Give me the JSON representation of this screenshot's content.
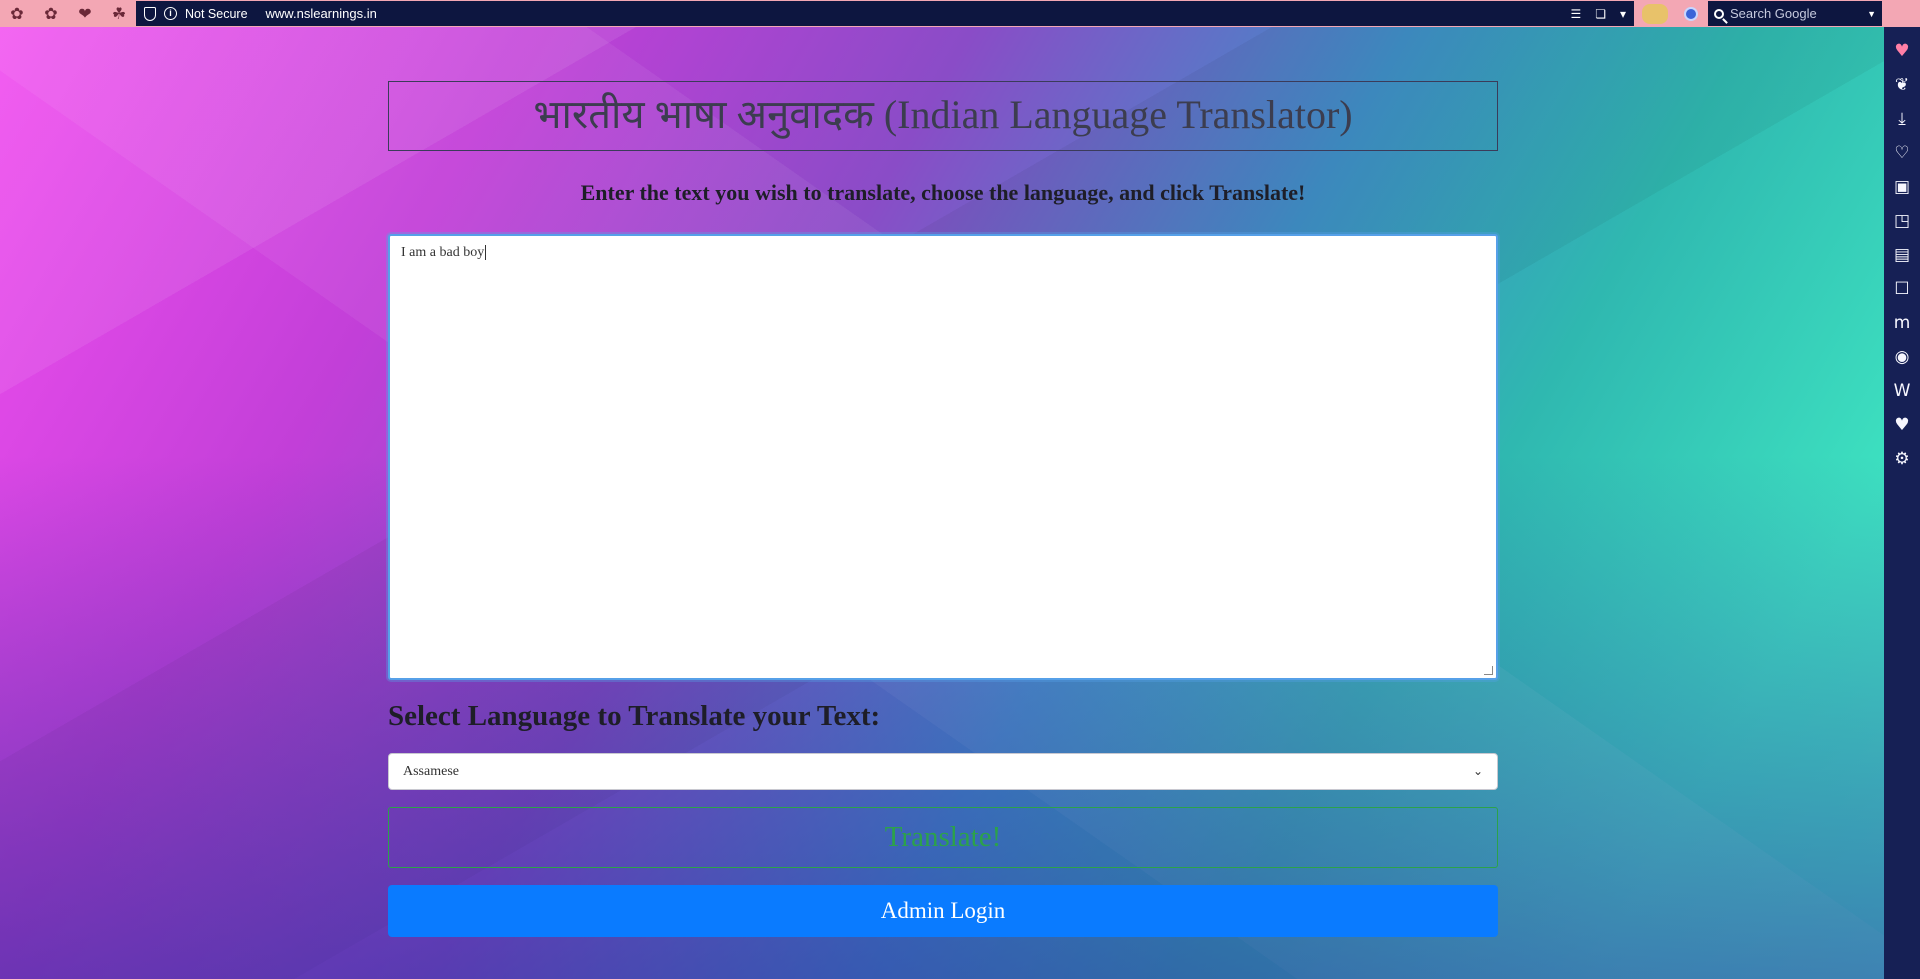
{
  "browser": {
    "tabs": [
      "tab-1",
      "tab-2",
      "tab-3",
      "tab-4"
    ],
    "security_label": "Not Secure",
    "url": "www.nslearnings.in",
    "search_placeholder": "Search Google"
  },
  "sidebar": {
    "icons": [
      "heart-icon",
      "hearts-stack-icon",
      "download-icon",
      "heart-plus-icon",
      "bookmark-heart-icon",
      "window-icon",
      "translate-icon",
      "chat-icon",
      "mastodon-icon",
      "vivaldi-icon",
      "wikipedia-icon",
      "heart-add-icon",
      "gear-icon"
    ]
  },
  "page": {
    "title": "भारतीय भाषा अनुवादक (Indian Language Translator)",
    "subtitle": "Enter the text you wish to translate, choose the language, and click Translate!",
    "input_text": "I am a bad boy",
    "select_label": "Select Language to Translate your Text:",
    "selected_language": "Assamese",
    "translate_label": "Translate!",
    "admin_label": "Admin Login"
  },
  "colors": {
    "accent_blue": "#0a7bff",
    "translate_green": "#2ca24a",
    "chrome_pink": "#f3a7b4",
    "chrome_dark": "#0d1640"
  }
}
